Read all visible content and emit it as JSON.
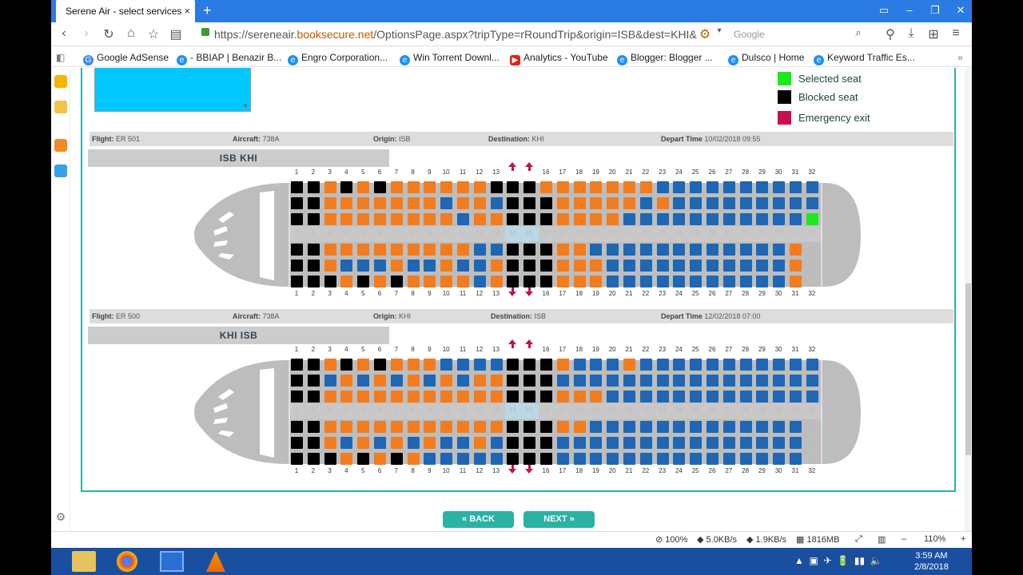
{
  "browser": {
    "tab_title": "Serene Air - select services",
    "tab_close": "×",
    "new_tab": "+",
    "url_prefix": "https://sereneair.",
    "url_host": "booksecure.net",
    "url_rest": "/OptionsPage.aspx?tripType=rRoundTrip&origin=ISB&dest=KHI&",
    "search_placeholder": "Google"
  },
  "bookmarks": [
    {
      "label": "Google AdSense",
      "icon": "google-g",
      "color": "#4285f4"
    },
    {
      "label": "- BBIAP | Benazir B...",
      "icon": "ie-e",
      "color": "#1e90ff"
    },
    {
      "label": "Engro Corporation...",
      "icon": "ie-e",
      "color": "#1e90ff"
    },
    {
      "label": "Win Torrent Downl...",
      "icon": "ie-e",
      "color": "#1e90ff"
    },
    {
      "label": "Analytics - YouTube",
      "icon": "youtube",
      "color": "#e62117"
    },
    {
      "label": "Blogger: Blogger ...",
      "icon": "ie-e",
      "color": "#1e90ff"
    },
    {
      "label": "Dulsco | Home",
      "icon": "ie-e",
      "color": "#1e90ff"
    },
    {
      "label": "Keyword Traffic Es...",
      "icon": "ie-e",
      "color": "#1e90ff"
    }
  ],
  "legend": [
    {
      "label": "Selected seat",
      "color": "#1ee81e"
    },
    {
      "label": "Blocked seat",
      "color": "#000000"
    },
    {
      "label": "Emergency exit",
      "color": "#c8104a"
    }
  ],
  "flights": [
    {
      "flight_label": "Flight:",
      "flight_value": "ER 501",
      "aircraft_label": "Aircraft:",
      "aircraft_value": "738A",
      "origin_label": "Origin:",
      "origin_value": "ISB",
      "destination_label": "Destination:",
      "destination_value": "KHI",
      "depart_label": "Depart Time",
      "depart_value": "10/02/2018 09:55",
      "route": "ISB   KHI",
      "rows": [
        "BBOBOBOOOOOOBBBOOOOOOOLLLLLLLLLL",
        "BBOOOOOOOLOOLBBBOOOOOLOLLLLLLLLL",
        "BBOOOOOOOOLOOBBBOOOOLLLLLLLLLLLG",
        "BBOOOOOOOOOLLBBBOOLLLLLLLLLLLLO_",
        "BBOLLLOLLOLLOBBBOOOLLLLLLLLLLLO_",
        "BBBOBOBOOOOLOBBBOOOLLLLLLLLLLLO_"
      ]
    },
    {
      "flight_label": "Flight:",
      "flight_value": "ER 500",
      "aircraft_label": "Aircraft:",
      "aircraft_value": "738A",
      "origin_label": "Origin:",
      "origin_value": "KHI",
      "destination_label": "Destination:",
      "destination_value": "ISB",
      "depart_label": "Depart Time",
      "depart_value": "12/02/2018 07:00",
      "route": "KHI   ISB",
      "rows": [
        "BBOBOBOOOLLLLBBBOLLLOLLLLLLLLLLL",
        "BBLOLOLOLOLOOBBBLLLLLLLLLLLLLLLL",
        "BBOOOOOOOOOOOBBBOOOLLLLLLLLLLLLL",
        "BBOOOOOOOOOOOBBBOOLLLLLLLLLLLLL_",
        "BBOLOLOLOLLOLBBBLLLLLLLLLLLLLLL_",
        "BBBOBOBOLLLLLBBBLLLLLLLLLLLLLLL_"
      ]
    }
  ],
  "seat_numbers": [
    "1",
    "2",
    "3",
    "4",
    "5",
    "6",
    "7",
    "8",
    "9",
    "10",
    "11",
    "12",
    "13",
    "14",
    "15",
    "16",
    "17",
    "18",
    "19",
    "20",
    "21",
    "22",
    "23",
    "24",
    "25",
    "26",
    "27",
    "28",
    "29",
    "30",
    "31",
    "32"
  ],
  "buttons": {
    "back": "« BACK",
    "next": "NEXT »"
  },
  "status": {
    "zoom_page": "100%",
    "down": "5.0KB/s",
    "up": "1.9KB/s",
    "mem": "1816MB",
    "zoom": "110%"
  },
  "clock": {
    "time": "3:59 AM",
    "date": "2/8/2018"
  }
}
